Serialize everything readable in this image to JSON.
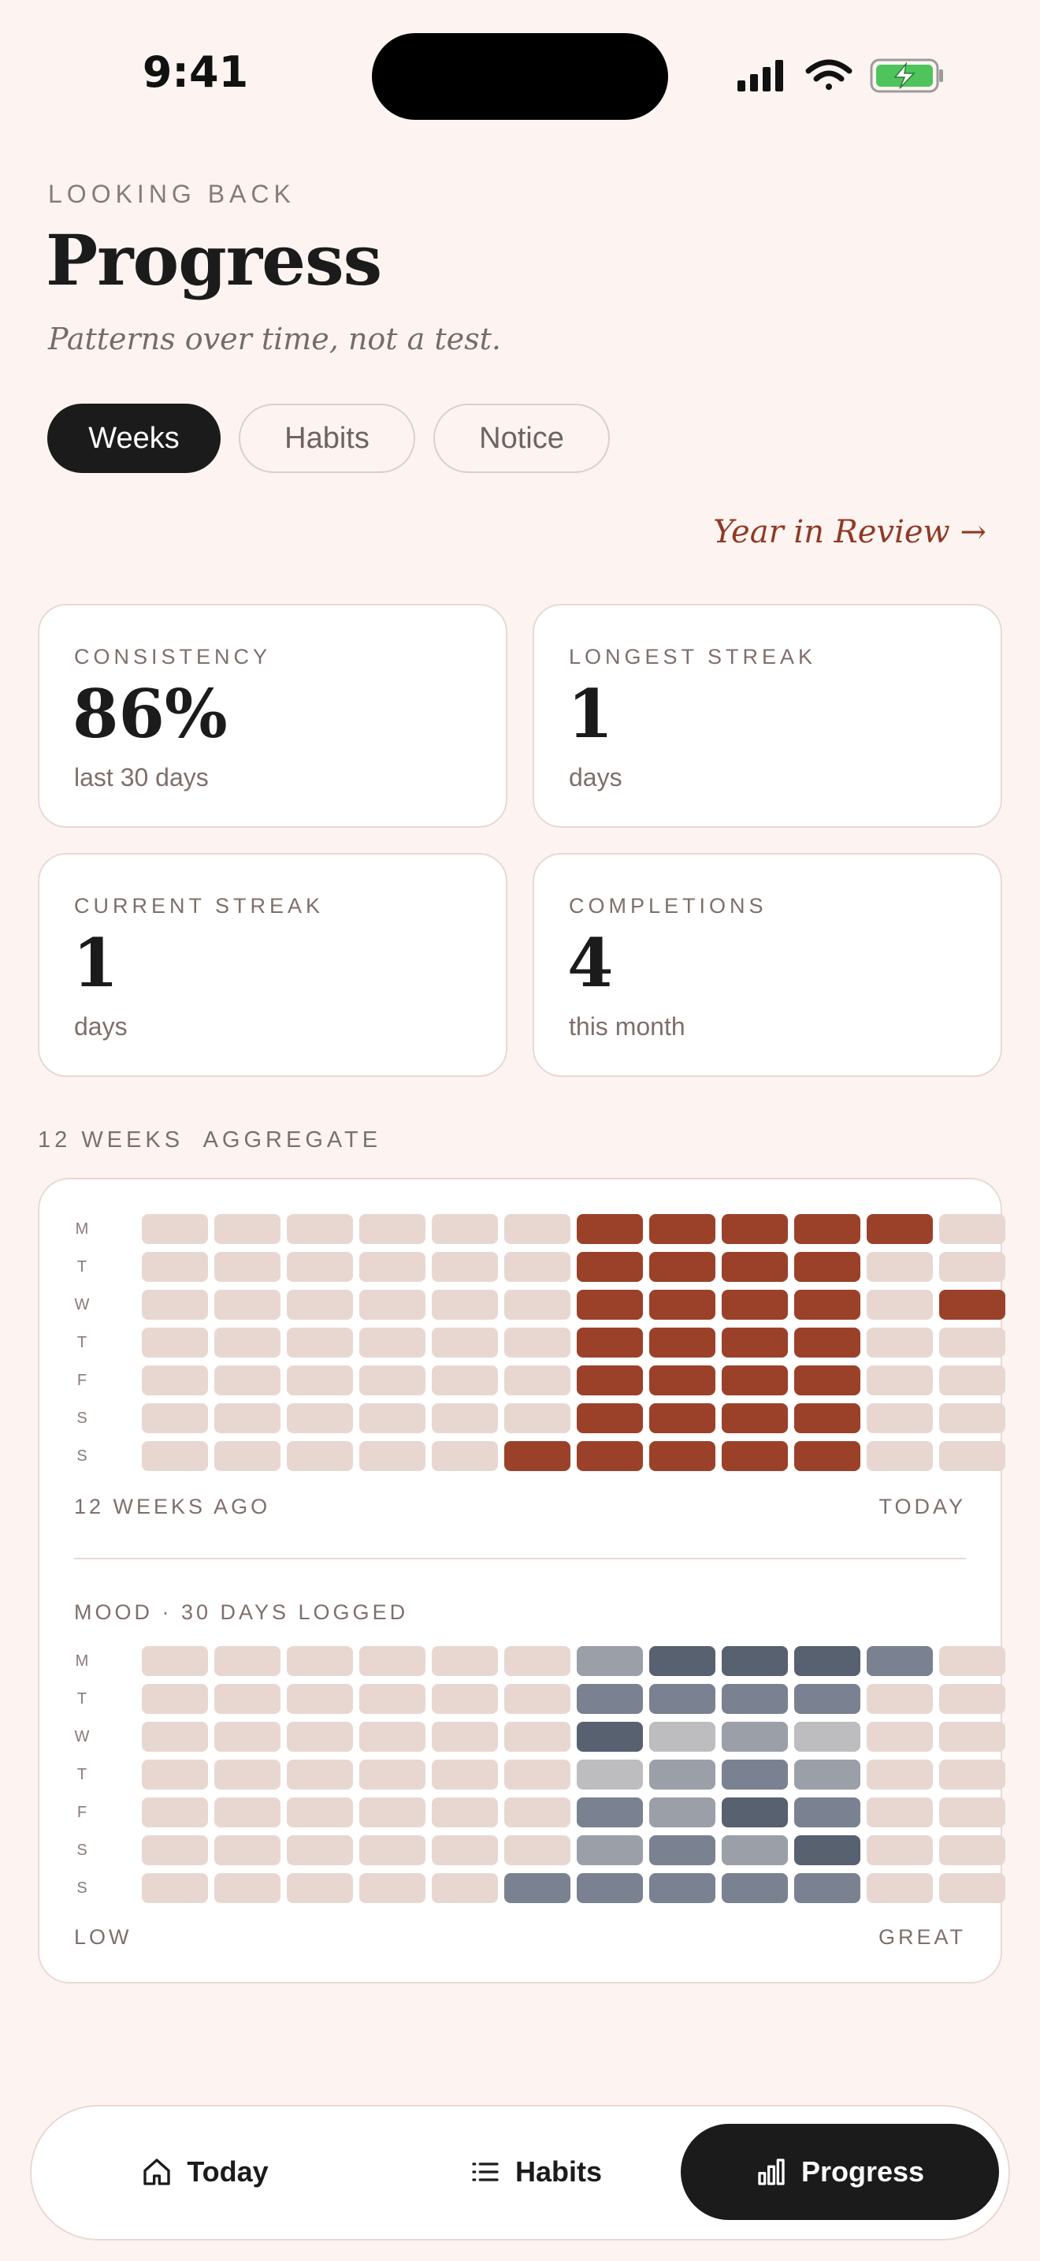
{
  "status_bar": {
    "time": "9:41"
  },
  "header": {
    "eyebrow": "LOOKING BACK",
    "title": "Progress",
    "subtitle": "Patterns over time, not a test."
  },
  "tabs": [
    {
      "label": "Weeks",
      "active": true
    },
    {
      "label": "Habits",
      "active": false
    },
    {
      "label": "Notice",
      "active": false
    }
  ],
  "year_in_review_link": "Year in Review →",
  "stats": [
    {
      "label": "CONSISTENCY",
      "value": "86%",
      "sub": "last 30 days"
    },
    {
      "label": "LONGEST STREAK",
      "value": "1",
      "sub": "days"
    },
    {
      "label": "CURRENT STREAK",
      "value": "1",
      "sub": "days"
    },
    {
      "label": "COMPLETIONS",
      "value": "4",
      "sub": "this month"
    }
  ],
  "section_label": "12 WEEKS  AGGREGATE",
  "day_labels": [
    "M",
    "T",
    "W",
    "T",
    "F",
    "S",
    "S"
  ],
  "completion_grid": {
    "start_label": "12 WEEKS AGO",
    "end_label": "TODAY",
    "weeks": 12,
    "rows": [
      [
        0,
        0,
        0,
        0,
        0,
        0,
        1,
        1,
        1,
        1,
        1,
        0
      ],
      [
        0,
        0,
        0,
        0,
        0,
        0,
        1,
        1,
        1,
        1,
        0,
        0
      ],
      [
        0,
        0,
        0,
        0,
        0,
        0,
        1,
        1,
        1,
        1,
        0,
        1
      ],
      [
        0,
        0,
        0,
        0,
        0,
        0,
        1,
        1,
        1,
        1,
        0,
        0
      ],
      [
        0,
        0,
        0,
        0,
        0,
        0,
        1,
        1,
        1,
        1,
        0,
        0
      ],
      [
        0,
        0,
        0,
        0,
        0,
        0,
        1,
        1,
        1,
        1,
        0,
        0
      ],
      [
        0,
        0,
        0,
        0,
        0,
        1,
        1,
        1,
        1,
        1,
        0,
        0
      ]
    ]
  },
  "mood_grid": {
    "label": "MOOD · 30 DAYS LOGGED",
    "low_label": "LOW",
    "high_label": "GREAT",
    "rows": [
      [
        0,
        0,
        0,
        0,
        0,
        0,
        3,
        5,
        5,
        5,
        4,
        0
      ],
      [
        0,
        0,
        0,
        0,
        0,
        0,
        4,
        4,
        4,
        4,
        0,
        0
      ],
      [
        0,
        0,
        0,
        0,
        0,
        0,
        5,
        2,
        3,
        2,
        0,
        0
      ],
      [
        0,
        0,
        0,
        0,
        0,
        0,
        2,
        3,
        4,
        3,
        0,
        0
      ],
      [
        0,
        0,
        0,
        0,
        0,
        0,
        4,
        3,
        5,
        4,
        0,
        0
      ],
      [
        0,
        0,
        0,
        0,
        0,
        0,
        3,
        4,
        3,
        5,
        0,
        0
      ],
      [
        0,
        0,
        0,
        0,
        0,
        4,
        4,
        4,
        4,
        4,
        0,
        0
      ]
    ]
  },
  "colors": {
    "empty": "#e8d7d1",
    "done": "#9b412a",
    "mood_levels": [
      "#e8d7d1",
      "#bdbcbf",
      "#bdbcbf",
      "#9a9fa8",
      "#7a8190",
      "#586170"
    ],
    "accent": "#8f3a25"
  },
  "nav": [
    {
      "label": "Today",
      "icon": "home-icon",
      "active": false
    },
    {
      "label": "Habits",
      "icon": "list-icon",
      "active": false
    },
    {
      "label": "Progress",
      "icon": "bar-chart-icon",
      "active": true
    }
  ]
}
